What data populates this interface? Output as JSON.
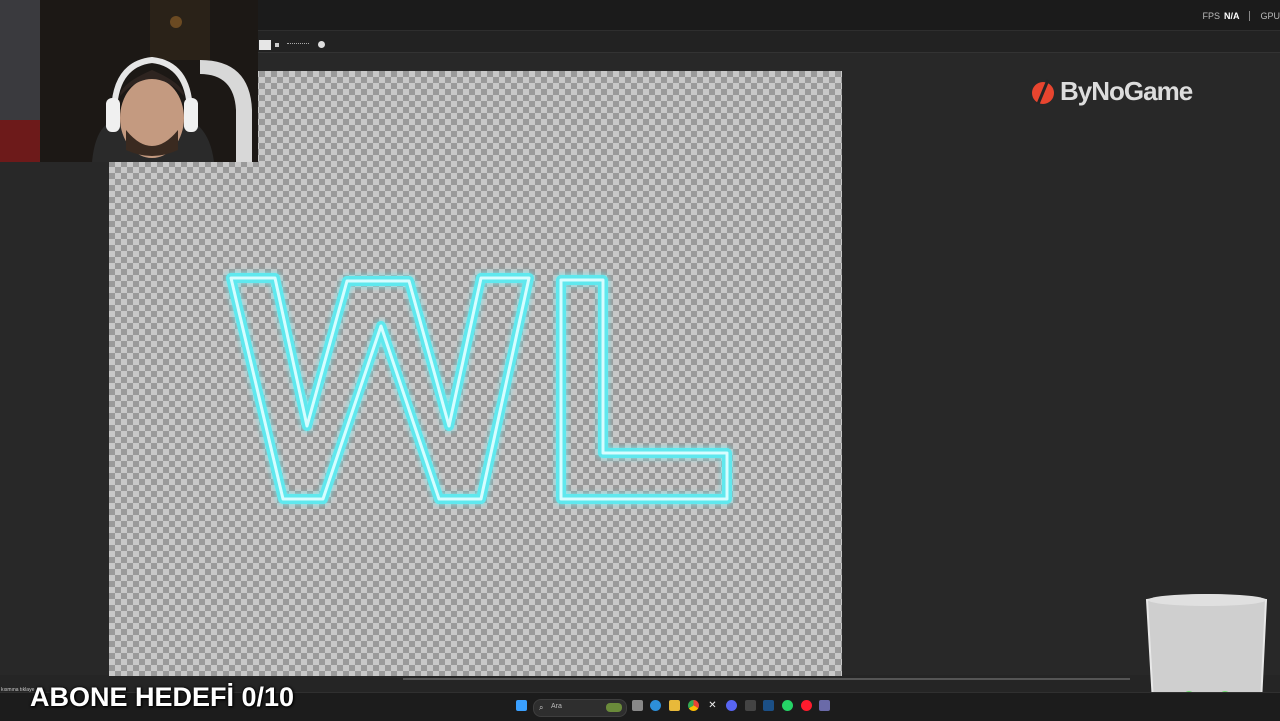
{
  "topbar": {
    "fps_label": "FPS",
    "fps_value": "N/A",
    "gpu_label": "GPU"
  },
  "canvas": {
    "artwork_text": "WL",
    "artwork_color": "#5fe8ee"
  },
  "overlay": {
    "brand_logo": "ByNoGame",
    "brand_color": "#e8452f",
    "subscriber_goal": "ABONE HEDEFİ 0/10",
    "ticker_text": "kısmına tıklaye"
  },
  "taskbar": {
    "search_placeholder": "Ara",
    "apps": [
      "start-icon",
      "search-icon",
      "task-view-icon",
      "edge-icon",
      "file-explorer-icon",
      "chrome-icon",
      "x-icon",
      "discord-icon",
      "store-icon",
      "steam-icon",
      "whatsapp-icon",
      "opera-icon",
      "notepad-icon"
    ]
  }
}
